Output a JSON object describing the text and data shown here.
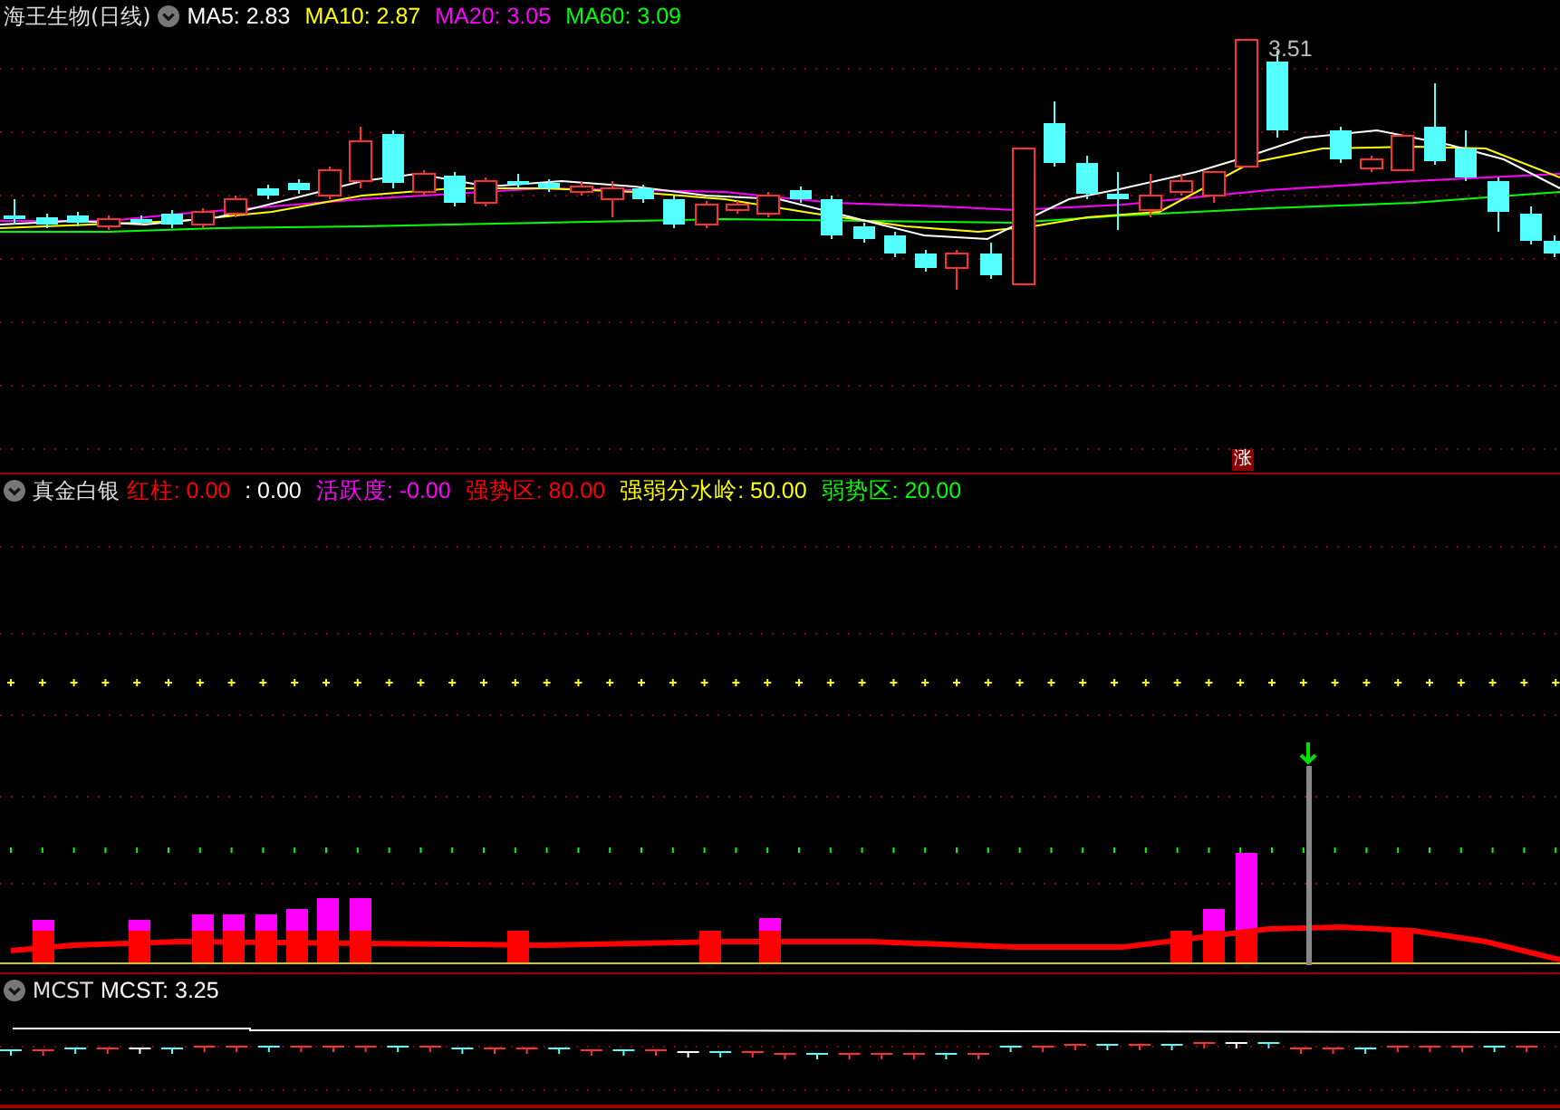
{
  "main_panel": {
    "title": "海王生物(日线)",
    "indicators": [
      {
        "label": "MA5: 2.83",
        "color": "#ffffff"
      },
      {
        "label": "MA10: 2.87",
        "color": "#ffff00"
      },
      {
        "label": "MA20: 3.05",
        "color": "#ff00ff"
      },
      {
        "label": "MA60: 3.09",
        "color": "#00ff00"
      }
    ],
    "high_label": "3.51",
    "badge": "涨"
  },
  "indicator_panel": {
    "title": "真金白银",
    "indicators": [
      {
        "label": "红柱: 0.00",
        "color": "#ff0000"
      },
      {
        "label": ": 0.00",
        "color": "#ffffff"
      },
      {
        "label": "活跃度: -0.00",
        "color": "#ff00ff"
      },
      {
        "label": "强势区: 80.00",
        "color": "#ff0000"
      },
      {
        "label": "强弱分水岭: 50.00",
        "color": "#ffff00"
      },
      {
        "label": "弱势区: 20.00",
        "color": "#00ff00"
      }
    ]
  },
  "mcst_panel": {
    "title": "MCST",
    "indicators": [
      {
        "label": "MCST: 3.25",
        "color": "#ffffff"
      }
    ]
  }
}
